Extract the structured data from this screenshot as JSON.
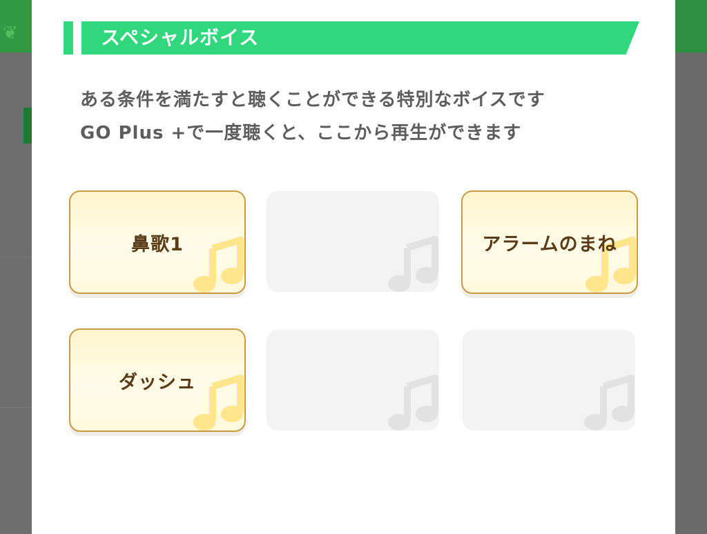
{
  "background": {
    "header_color": "#2f9a44",
    "logo_icon": "app-logo-icon"
  },
  "modal": {
    "title": "スペシャルボイス",
    "title_color": "#30d77c",
    "description_line1": "ある条件を満たすと聴くことができる特別なボイスです",
    "description_line2": "GO Plus +で一度聴くと、ここから再生ができます"
  },
  "voices": [
    {
      "label": "鼻歌1",
      "unlocked": true,
      "icon": "music-note-icon"
    },
    {
      "label": "",
      "unlocked": false,
      "icon": "music-note-icon"
    },
    {
      "label": "アラームのまね",
      "unlocked": true,
      "icon": "music-note-icon"
    },
    {
      "label": "ダッシュ",
      "unlocked": true,
      "icon": "music-note-icon"
    },
    {
      "label": "",
      "unlocked": false,
      "icon": "music-note-icon"
    },
    {
      "label": "",
      "unlocked": false,
      "icon": "music-note-icon"
    }
  ],
  "colors": {
    "card_active_border": "#c79a45",
    "card_locked_bg": "#f3f3f3",
    "label_text": "#5a3b17"
  }
}
